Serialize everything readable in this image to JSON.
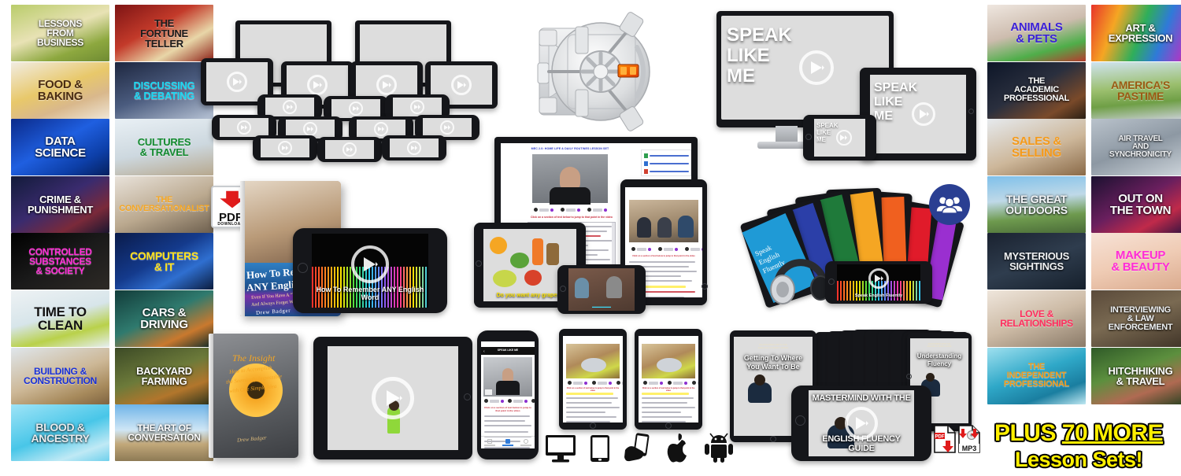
{
  "lesson_tiles_left": [
    {
      "name": "lessons-from-business",
      "lines": [
        "LESSONS",
        "FROM",
        "BUSINESS"
      ],
      "color": "#ffffff",
      "size": 12,
      "bg": "linear-gradient(160deg,#b9cc6a,#e8e2b5 45%,#8da83f 75%,#6f8b33)"
    },
    {
      "name": "the-fortune-teller",
      "lines": [
        "THE",
        "FORTUNE",
        "TELLER"
      ],
      "color": "#1a1a1a",
      "size": 13,
      "bg": "linear-gradient(150deg,#7d1414,#c33a2a 40%,#e8d6a8 70%,#8e2118)"
    },
    {
      "name": "food-and-baking",
      "lines": [
        "FOOD &",
        "BAKING"
      ],
      "color": "#4a2c12",
      "size": 15,
      "bg": "linear-gradient(160deg,#f1ece2,#e8c86a 45%,#d9b88c 70%,#efe6d6)"
    },
    {
      "name": "discussing-and-debating",
      "lines": [
        "DISCUSSING",
        "& DEBATING"
      ],
      "color": "#18d8f2",
      "size": 13,
      "bg": "linear-gradient(160deg,#1e2740,#4a5b7e 50%,#b6c2d4)"
    },
    {
      "name": "data-science",
      "lines": [
        "DATA",
        "SCIENCE"
      ],
      "color": "#ffffff",
      "size": 15,
      "bg": "linear-gradient(150deg,#0b2a8a,#1f5fe0 45%,#0d3fa8 75%,#06205e)"
    },
    {
      "name": "cultures-and-travel",
      "lines": [
        "CULTURES",
        "& TRAVEL"
      ],
      "color": "#128a2e",
      "size": 13,
      "bg": "linear-gradient(170deg,#e9f0f5,#cdd8df 55%,#b7a88e)"
    },
    {
      "name": "crime-and-punishment",
      "lines": [
        "CRIME &",
        "PUNISHMENT"
      ],
      "color": "#ffffff",
      "size": 13,
      "bg": "linear-gradient(150deg,#121b3a,#3a2b6e 45%,#7a2a3a 75%,#1a1630)"
    },
    {
      "name": "the-conversationalist",
      "lines": [
        "THE",
        "CONVERSATIONALIST"
      ],
      "color": "#f5a623",
      "size": 11,
      "bg": "linear-gradient(160deg,#e8e2da,#bba98f 55%,#6d5f4e)"
    },
    {
      "name": "controlled-substances-and-society",
      "lines": [
        "CONTROLLED",
        "SUBSTANCES",
        "& SOCIETY"
      ],
      "color": "#ff2bd6",
      "size": 12,
      "bg": "linear-gradient(150deg,#000000,#1a1a1a 50%,#2e2a26)"
    },
    {
      "name": "computers-and-it",
      "lines": [
        "COMPUTERS",
        "& IT"
      ],
      "color": "#ffe11a",
      "size": 14,
      "bg": "linear-gradient(150deg,#0a1b4a,#143a8c 45%,#2f6fd0 70%,#0b1c3e)"
    },
    {
      "name": "time-to-clean",
      "lines": [
        "TIME TO",
        "CLEAN"
      ],
      "color": "#111111",
      "size": 17,
      "bg": "linear-gradient(165deg,#eef2f4,#d7e5ea 45%,#b9d14a 72%,#e6eef0)"
    },
    {
      "name": "cars-and-driving",
      "lines": [
        "CARS &",
        "DRIVING"
      ],
      "color": "#ffffff",
      "size": 15,
      "bg": "linear-gradient(155deg,#123c3a,#2f7a6e 45%,#c9792e 75%,#0f2c2a)"
    },
    {
      "name": "building-and-construction",
      "lines": [
        "BUILDING &",
        "CONSTRUCTION"
      ],
      "color": "#1830d8",
      "size": 12,
      "bg": "linear-gradient(160deg,#dfe6ec,#cdb897 50%,#a78a5c 78%,#7e6340)"
    },
    {
      "name": "backyard-farming",
      "lines": [
        "BACKYARD",
        "FARMING"
      ],
      "color": "#ffffff",
      "size": 13,
      "bg": "linear-gradient(160deg,#3c4a26,#6c7a3a 45%,#b2762c 72%,#2a331c)"
    },
    {
      "name": "blood-and-ancestry",
      "lines": [
        "BLOOD &",
        "ANCESTRY"
      ],
      "color": "#e8ecef",
      "size": 14,
      "bg": "linear-gradient(160deg,#9fe4f7,#48c6e8 50%,#bfe9f5 80%,#6fd0ec)"
    },
    {
      "name": "the-art-of-conversation",
      "lines": [
        "THE ART OF",
        "CONVERSATION"
      ],
      "color": "#ffffff",
      "size": 12,
      "bg": "linear-gradient(180deg,#6fb4e8,#cfe6f5 45%,#c2a87a 70%,#8d7a55)"
    }
  ],
  "lesson_tiles_right": [
    {
      "name": "animals-and-pets",
      "lines": [
        "ANIMALS",
        "& PETS"
      ],
      "color": "#3a1fd8",
      "size": 15,
      "bg": "linear-gradient(165deg,#efe7e0,#cdbcae 45%,#4fae4a 75%,#b63b2e)"
    },
    {
      "name": "art-and-expression",
      "lines": [
        "ART &",
        "EXPRESSION"
      ],
      "color": "#ffffff",
      "size": 13,
      "bg": "linear-gradient(110deg,#e8342a,#f5a623 25%,#2fae5a 50%,#2f7ad8 70%,#a03fc8 90%,#e8342a)"
    },
    {
      "name": "the-academic-professional",
      "lines": [
        "THE",
        "ACADEMIC",
        "PROFESSIONAL"
      ],
      "color": "#ffffff",
      "size": 11,
      "bg": "linear-gradient(150deg,#0d1628,#2a2f3e 45%,#7a4a2a 78%,#2a1f14)"
    },
    {
      "name": "americas-pastime",
      "lines": [
        "AMERICA’S",
        "PASTIME"
      ],
      "color": "#9a5a12",
      "size": 14,
      "bg": "linear-gradient(175deg,#cfe3ef,#9bbf6e 45%,#6f9f46 70%,#c9cfd4)"
    },
    {
      "name": "sales-and-selling",
      "lines": [
        "SALES &",
        "SELLING"
      ],
      "color": "#f59a1a",
      "size": 15,
      "bg": "linear-gradient(160deg,#e6eaee,#cdb79a 55%,#8a6a48)"
    },
    {
      "name": "air-travel-and-synchronicity",
      "lines": [
        "AIR TRAVEL",
        "AND",
        "SYNCHRONICITY"
      ],
      "color": "#f0f2f4",
      "size": 10,
      "bg": "linear-gradient(160deg,#b9c2cb,#8d98a3 50%,#cfd6dc)"
    },
    {
      "name": "the-great-outdoors",
      "lines": [
        "THE GREAT",
        "OUTDOORS"
      ],
      "color": "#f2f5f7",
      "size": 14,
      "bg": "linear-gradient(175deg,#7fc0ea,#bfd9e8 40%,#6e9a4e 70%,#4a6b38)"
    },
    {
      "name": "out-on-the-town",
      "lines": [
        "OUT ON",
        "THE TOWN"
      ],
      "color": "#ffffff",
      "size": 15,
      "bg": "linear-gradient(150deg,#1b1130,#6a1f5e 45%,#c02a4a 72%,#2a1240)"
    },
    {
      "name": "mysterious-sightings",
      "lines": [
        "MYSTERIOUS",
        "SIGHTINGS"
      ],
      "color": "#f0f2f4",
      "size": 13,
      "bg": "linear-gradient(160deg,#1a2230,#2f3d4e 50%,#16202c)"
    },
    {
      "name": "makeup-and-beauty",
      "lines": [
        "MAKEUP",
        "& BEAUTY"
      ],
      "color": "#ff2bd6",
      "size": 15,
      "bg": "linear-gradient(165deg,#f7e2d6,#efcbb4 50%,#d9a98c)"
    },
    {
      "name": "love-and-relationships",
      "lines": [
        "LOVE &",
        "RELATIONSHIPS"
      ],
      "color": "#ff2d5e",
      "size": 12,
      "bg": "linear-gradient(160deg,#efe6dc,#cdbba6 50%,#8a7a68)"
    },
    {
      "name": "interviewing-and-law-enforcement",
      "lines": [
        "INTERVIEWING",
        "& LAW",
        "ENFORCEMENT"
      ],
      "color": "#eef1f3",
      "size": 11,
      "bg": "linear-gradient(160deg,#5a4a3a,#7a6a52 45%,#3e3226)"
    },
    {
      "name": "the-independent-professional",
      "lines": [
        "THE",
        "INDEPENDENT",
        "PROFESSIONAL"
      ],
      "color": "#f59a1a",
      "size": 11,
      "bg": "linear-gradient(160deg,#9fe0ef,#2fa8c8 45%,#1a7ea0 75%,#bfe8f2)"
    },
    {
      "name": "hitchhiking-and-travel",
      "lines": [
        "HITCHHIKING",
        "& TRAVEL"
      ],
      "color": "#ffffff",
      "size": 13,
      "bg": "linear-gradient(160deg,#2f5a28,#5c8f3e 40%,#b06a52 70%,#23401f)"
    }
  ],
  "plus_more": {
    "line1_a": "PLUS ",
    "line1_b": "70 MORE",
    "line2": "Lesson Sets!",
    "color": "#ffef00"
  },
  "speak_like_me": {
    "l1": "SPEAK",
    "l2": "LIKE",
    "l3": "ME"
  },
  "audio_phone": {
    "caption": "How To Remember ANY English Word"
  },
  "ebook_remember": {
    "title_1": "How To Remember",
    "title_2": "ANY English Word",
    "sub_1": "Even If You Have A “Terrible” Memory",
    "sub_2": "And Always Forget Words When Speaking",
    "author": "Drew Badger"
  },
  "ebook_insight": {
    "title": "The Insight",
    "sub_1": "How to Accomplish",
    "sub_2": "the Seemingly Impossible",
    "sub_3": "with One Simple Idea",
    "author": "Drew Badger"
  },
  "pdf_badge": {
    "label": "PDF",
    "sub": "DOWNLOAD"
  },
  "download_badges": [
    {
      "label": "PDF"
    },
    {
      "label": "MP3"
    }
  ],
  "browser_lesson": {
    "title": "MEC 2.0: HOME LIFE & DAILY ROUTINES LESSON SET",
    "instruction": "Click on a section of text below to jump to that point in the video",
    "attachments": [
      "Home_Life_and_Daily_Routines_P",
      "Home_Life_and_Daily_Routines_P",
      "Home_Life_and_Daily_Routines_P"
    ],
    "controls": [
      "normal",
      "none",
      "none"
    ]
  },
  "fridge_caption": "Do you want any grapes?",
  "speak_like_me_app": {
    "nav_title": "SPEAK LIKE ME",
    "instruction": "Click on a section of text below to jump to that point in the video",
    "tabs": [
      "Overview",
      "Exercises",
      "Search"
    ]
  },
  "audio_bundle": {
    "caption": "Speak English Fluently",
    "card_title": "Speak English Fluently"
  },
  "mastermind": {
    "tablet_1": "Getting To Where You Want To Be",
    "tablet_2": "Understanding Fluency",
    "phone_top": "MASTERMIND WITH THE",
    "phone_bottom": "ENGLISH FLUENCY GUIDE"
  },
  "os_icons": [
    "desktop-icon",
    "tablet-icon",
    "hand-phone-icon",
    "apple-icon",
    "android-icon"
  ],
  "community_icon": {
    "name": "community-group-icon",
    "color": "#2a3f92"
  },
  "vault": {
    "name": "vault-door-icon",
    "dial_color": "#ff5a00"
  }
}
